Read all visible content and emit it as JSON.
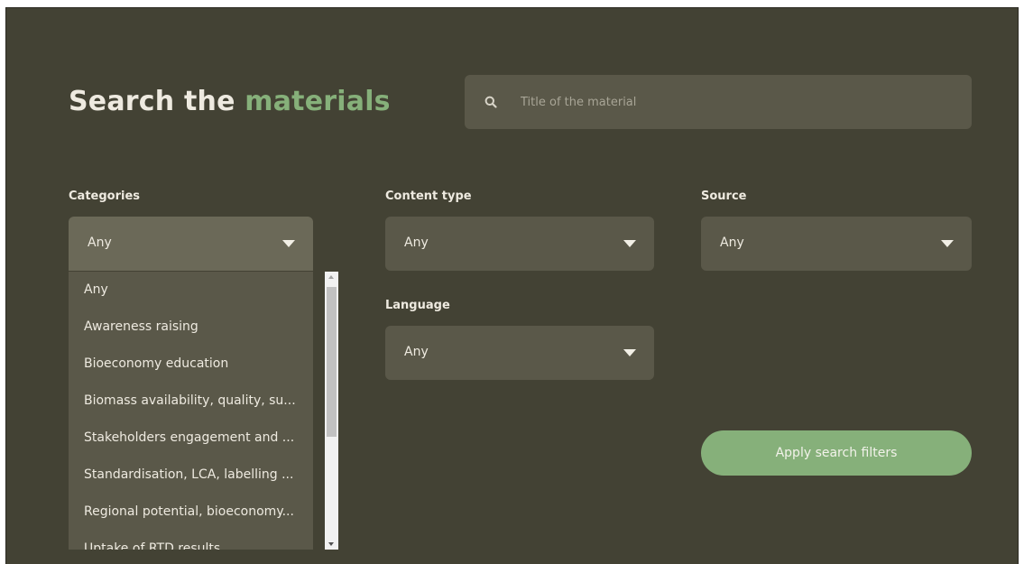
{
  "heading": {
    "prefix": "Search the",
    "accent": "materials"
  },
  "search": {
    "placeholder": "Title of the material",
    "value": ""
  },
  "filters": {
    "categories": {
      "label": "Categories",
      "value": "Any"
    },
    "content_type": {
      "label": "Content type",
      "value": "Any"
    },
    "source": {
      "label": "Source",
      "value": "Any"
    },
    "language": {
      "label": "Language",
      "value": "Any"
    }
  },
  "categories_options": [
    "Any",
    "Awareness raising",
    "Bioeconomy education",
    "Biomass availability, quality, su...",
    "Stakeholders engagement and ...",
    "Standardisation, LCA, labelling ...",
    "Regional potential, bioeconomy...",
    "Uptake of RTD results"
  ],
  "apply_button": "Apply search filters",
  "colors": {
    "background": "#434234",
    "field": "#5a5849",
    "accent": "#86b07a",
    "text": "#eeeae0"
  },
  "icons": {
    "search": "search-icon",
    "dropdown": "caret-down-icon"
  }
}
